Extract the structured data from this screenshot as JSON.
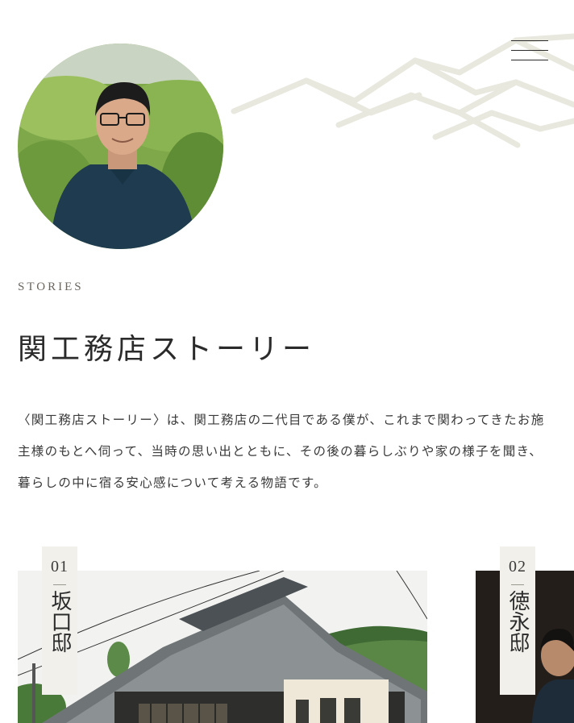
{
  "header": {
    "menu_icon": "hamburger-menu-icon"
  },
  "hero": {
    "portrait_alt": "portrait-photo",
    "section_label": "STORIES",
    "title": "関工務店ストーリー",
    "intro": "〈関工務店ストーリー〉は、関工務店の二代目である僕が、これまで関わってきたお施主様のもとへ伺って、当時の思い出とともに、その後の暮らしぶりや家の様子を聞き、暮らしの中に宿る安心感について考える物語です。"
  },
  "stories": [
    {
      "number": "01",
      "name": "坂口邸"
    },
    {
      "number": "02",
      "name": "徳永邸"
    }
  ],
  "colors": {
    "tag_bg": "#f1f0ea",
    "text": "#2b2b2b",
    "pattern": "#e6e6dc"
  }
}
